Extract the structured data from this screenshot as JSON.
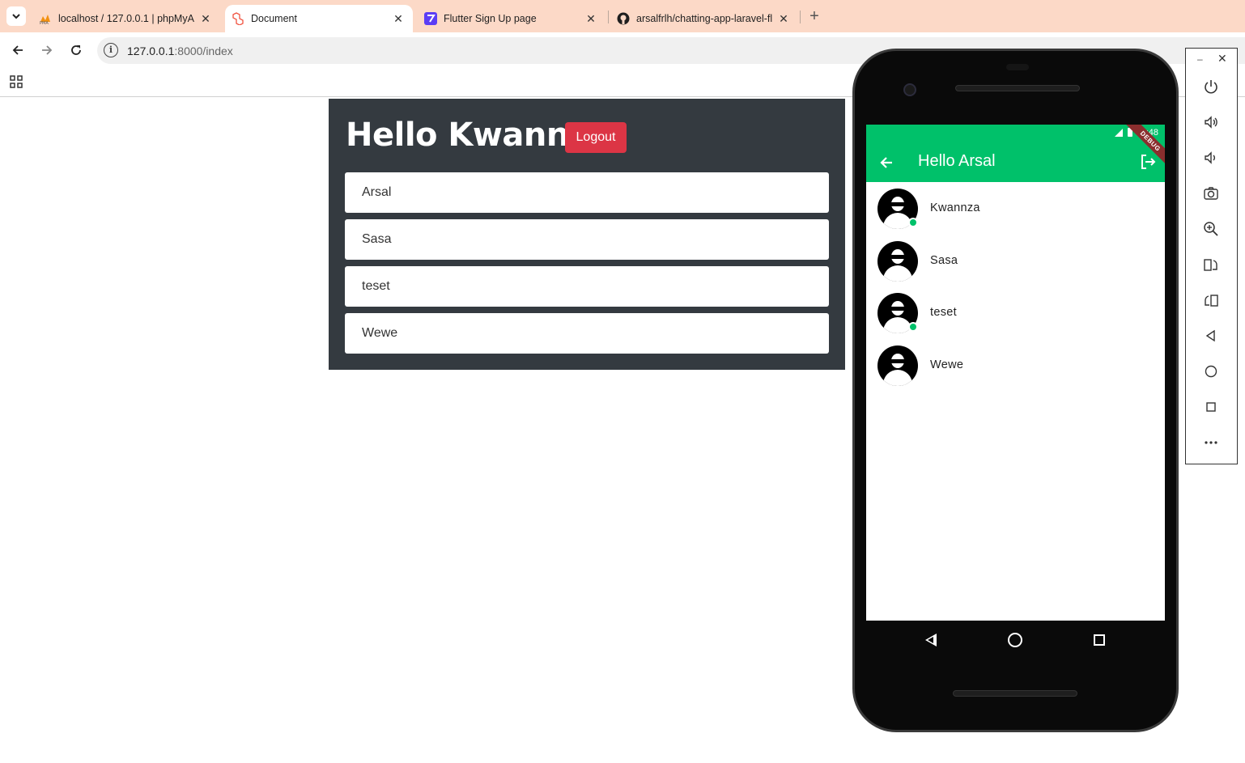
{
  "browser": {
    "tabs": [
      {
        "title": "localhost / 127.0.0.1 | phpMyAd",
        "favicon": "phpmyadmin-icon",
        "active": false
      },
      {
        "title": "Document",
        "favicon": "laravel-icon",
        "active": true
      },
      {
        "title": "Flutter Sign Up page",
        "favicon": "flutterflow-icon",
        "active": false
      },
      {
        "title": "arsalfrlh/chatting-app-laravel-fl",
        "favicon": "github-icon",
        "active": false
      }
    ],
    "new_tab": "+",
    "close_glyph": "✕",
    "url_host": "127.0.0.1",
    "url_path": ":8000/index"
  },
  "page": {
    "greeting": "Hello Kwannza",
    "logout_label": "Logout",
    "users": [
      "Arsal",
      "Sasa",
      "teset",
      "Wewe"
    ]
  },
  "phone": {
    "time": "6:48",
    "debug_banner": "DEBUG",
    "appbar_title": "Hello Arsal",
    "contacts": [
      {
        "name": "Kwannza",
        "online": true
      },
      {
        "name": "Sasa",
        "online": false
      },
      {
        "name": "teset",
        "online": true
      },
      {
        "name": "Wewe",
        "online": false
      }
    ],
    "accent_color": "#00c16a"
  },
  "emulator": {
    "minimize": "–",
    "close": "✕",
    "buttons": [
      "power-icon",
      "volume-up-icon",
      "volume-down-icon",
      "camera-icon",
      "zoom-in-icon",
      "rotate-right-icon",
      "rotate-left-icon",
      "back-icon",
      "home-icon",
      "overview-icon",
      "more-icon"
    ]
  },
  "colors": {
    "tabstrip": "#fcd9c7",
    "panel": "#343a40",
    "logout": "#dc3545"
  }
}
